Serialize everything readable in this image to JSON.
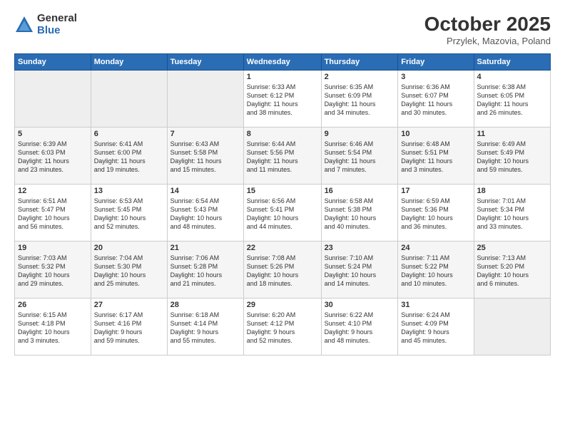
{
  "header": {
    "logo_general": "General",
    "logo_blue": "Blue",
    "month": "October 2025",
    "location": "Przylek, Mazovia, Poland"
  },
  "days_of_week": [
    "Sunday",
    "Monday",
    "Tuesday",
    "Wednesday",
    "Thursday",
    "Friday",
    "Saturday"
  ],
  "weeks": [
    [
      {
        "num": "",
        "info": ""
      },
      {
        "num": "",
        "info": ""
      },
      {
        "num": "",
        "info": ""
      },
      {
        "num": "1",
        "info": "Sunrise: 6:33 AM\nSunset: 6:12 PM\nDaylight: 11 hours\nand 38 minutes."
      },
      {
        "num": "2",
        "info": "Sunrise: 6:35 AM\nSunset: 6:09 PM\nDaylight: 11 hours\nand 34 minutes."
      },
      {
        "num": "3",
        "info": "Sunrise: 6:36 AM\nSunset: 6:07 PM\nDaylight: 11 hours\nand 30 minutes."
      },
      {
        "num": "4",
        "info": "Sunrise: 6:38 AM\nSunset: 6:05 PM\nDaylight: 11 hours\nand 26 minutes."
      }
    ],
    [
      {
        "num": "5",
        "info": "Sunrise: 6:39 AM\nSunset: 6:03 PM\nDaylight: 11 hours\nand 23 minutes."
      },
      {
        "num": "6",
        "info": "Sunrise: 6:41 AM\nSunset: 6:00 PM\nDaylight: 11 hours\nand 19 minutes."
      },
      {
        "num": "7",
        "info": "Sunrise: 6:43 AM\nSunset: 5:58 PM\nDaylight: 11 hours\nand 15 minutes."
      },
      {
        "num": "8",
        "info": "Sunrise: 6:44 AM\nSunset: 5:56 PM\nDaylight: 11 hours\nand 11 minutes."
      },
      {
        "num": "9",
        "info": "Sunrise: 6:46 AM\nSunset: 5:54 PM\nDaylight: 11 hours\nand 7 minutes."
      },
      {
        "num": "10",
        "info": "Sunrise: 6:48 AM\nSunset: 5:51 PM\nDaylight: 11 hours\nand 3 minutes."
      },
      {
        "num": "11",
        "info": "Sunrise: 6:49 AM\nSunset: 5:49 PM\nDaylight: 10 hours\nand 59 minutes."
      }
    ],
    [
      {
        "num": "12",
        "info": "Sunrise: 6:51 AM\nSunset: 5:47 PM\nDaylight: 10 hours\nand 56 minutes."
      },
      {
        "num": "13",
        "info": "Sunrise: 6:53 AM\nSunset: 5:45 PM\nDaylight: 10 hours\nand 52 minutes."
      },
      {
        "num": "14",
        "info": "Sunrise: 6:54 AM\nSunset: 5:43 PM\nDaylight: 10 hours\nand 48 minutes."
      },
      {
        "num": "15",
        "info": "Sunrise: 6:56 AM\nSunset: 5:41 PM\nDaylight: 10 hours\nand 44 minutes."
      },
      {
        "num": "16",
        "info": "Sunrise: 6:58 AM\nSunset: 5:38 PM\nDaylight: 10 hours\nand 40 minutes."
      },
      {
        "num": "17",
        "info": "Sunrise: 6:59 AM\nSunset: 5:36 PM\nDaylight: 10 hours\nand 36 minutes."
      },
      {
        "num": "18",
        "info": "Sunrise: 7:01 AM\nSunset: 5:34 PM\nDaylight: 10 hours\nand 33 minutes."
      }
    ],
    [
      {
        "num": "19",
        "info": "Sunrise: 7:03 AM\nSunset: 5:32 PM\nDaylight: 10 hours\nand 29 minutes."
      },
      {
        "num": "20",
        "info": "Sunrise: 7:04 AM\nSunset: 5:30 PM\nDaylight: 10 hours\nand 25 minutes."
      },
      {
        "num": "21",
        "info": "Sunrise: 7:06 AM\nSunset: 5:28 PM\nDaylight: 10 hours\nand 21 minutes."
      },
      {
        "num": "22",
        "info": "Sunrise: 7:08 AM\nSunset: 5:26 PM\nDaylight: 10 hours\nand 18 minutes."
      },
      {
        "num": "23",
        "info": "Sunrise: 7:10 AM\nSunset: 5:24 PM\nDaylight: 10 hours\nand 14 minutes."
      },
      {
        "num": "24",
        "info": "Sunrise: 7:11 AM\nSunset: 5:22 PM\nDaylight: 10 hours\nand 10 minutes."
      },
      {
        "num": "25",
        "info": "Sunrise: 7:13 AM\nSunset: 5:20 PM\nDaylight: 10 hours\nand 6 minutes."
      }
    ],
    [
      {
        "num": "26",
        "info": "Sunrise: 6:15 AM\nSunset: 4:18 PM\nDaylight: 10 hours\nand 3 minutes."
      },
      {
        "num": "27",
        "info": "Sunrise: 6:17 AM\nSunset: 4:16 PM\nDaylight: 9 hours\nand 59 minutes."
      },
      {
        "num": "28",
        "info": "Sunrise: 6:18 AM\nSunset: 4:14 PM\nDaylight: 9 hours\nand 55 minutes."
      },
      {
        "num": "29",
        "info": "Sunrise: 6:20 AM\nSunset: 4:12 PM\nDaylight: 9 hours\nand 52 minutes."
      },
      {
        "num": "30",
        "info": "Sunrise: 6:22 AM\nSunset: 4:10 PM\nDaylight: 9 hours\nand 48 minutes."
      },
      {
        "num": "31",
        "info": "Sunrise: 6:24 AM\nSunset: 4:09 PM\nDaylight: 9 hours\nand 45 minutes."
      },
      {
        "num": "",
        "info": ""
      }
    ]
  ]
}
